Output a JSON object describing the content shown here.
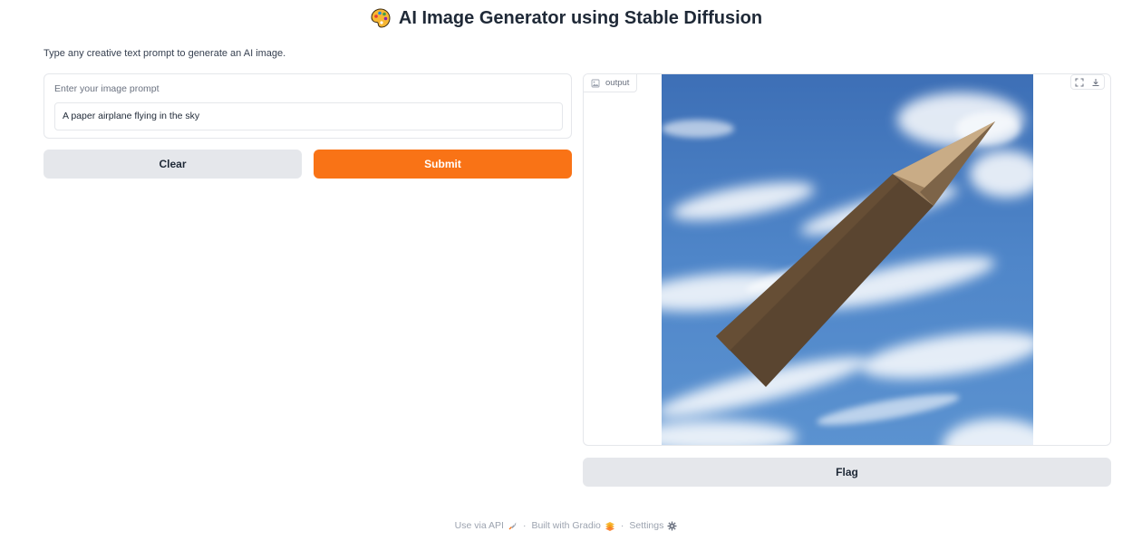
{
  "header": {
    "emoji_icon": "artist-palette-icon",
    "title": "AI Image Generator using Stable Diffusion"
  },
  "description": "Type any creative text prompt to generate an AI image.",
  "input_panel": {
    "label": "Enter your image prompt",
    "value": "A paper airplane flying in the sky"
  },
  "buttons": {
    "clear": "Clear",
    "submit": "Submit",
    "flag": "Flag"
  },
  "output_panel": {
    "label": "output",
    "tools": [
      "fullscreen-icon",
      "download-icon"
    ]
  },
  "footer": {
    "api": "Use via API",
    "built": "Built with Gradio",
    "settings": "Settings",
    "separator": "·"
  },
  "colors": {
    "accent": "#f97316",
    "secondary_button": "#e5e7eb",
    "border": "#e5e7eb",
    "text": "#1f2937",
    "muted": "#6b7280"
  }
}
